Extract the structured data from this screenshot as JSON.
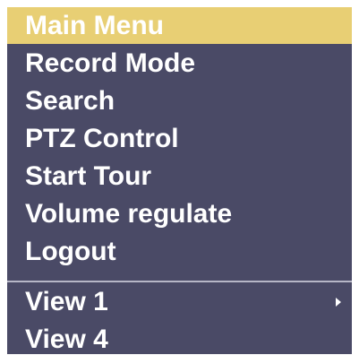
{
  "menu": {
    "items": [
      {
        "label": "Main Menu",
        "selected": true
      },
      {
        "label": "Record Mode"
      },
      {
        "label": "Search"
      },
      {
        "label": "PTZ Control"
      },
      {
        "label": "Start Tour"
      },
      {
        "label": "Volume regulate"
      },
      {
        "label": "Logout"
      }
    ],
    "view_items": [
      {
        "label": "View 1",
        "has_submenu": true,
        "icon": "chevron-right-icon"
      },
      {
        "label": "View 4"
      }
    ]
  },
  "colors": {
    "menu_background": "#4a4a66",
    "selected_background": "#e8cf74",
    "text": "#ffffff",
    "divider": "#b6b6c6"
  }
}
